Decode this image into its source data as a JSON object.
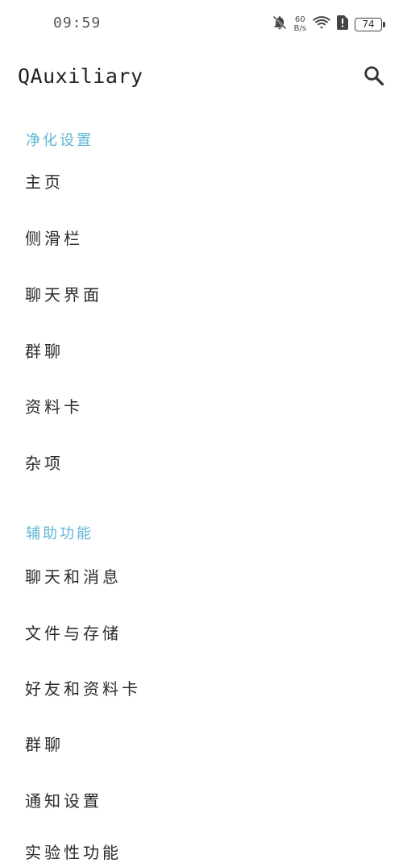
{
  "status_bar": {
    "time": "09:59",
    "net_speed_value": "60",
    "net_speed_unit": "B/s",
    "battery_level": "74",
    "icons": [
      "bell-off-icon",
      "wifi-icon",
      "sim-alert-icon",
      "battery-icon"
    ]
  },
  "app_bar": {
    "title": "QAuxiliary",
    "search_icon": "search-icon"
  },
  "sections": [
    {
      "header": "净化设置",
      "items": [
        "主页",
        "侧滑栏",
        "聊天界面",
        "群聊",
        "资料卡",
        "杂项"
      ]
    },
    {
      "header": "辅助功能",
      "items": [
        "聊天和消息",
        "文件与存储",
        "好友和资料卡",
        "群聊",
        "通知设置",
        "实验性功能"
      ]
    }
  ],
  "colors": {
    "section_header": "#5fb6d6",
    "text": "#2a2a2a",
    "background": "#ffffff"
  }
}
